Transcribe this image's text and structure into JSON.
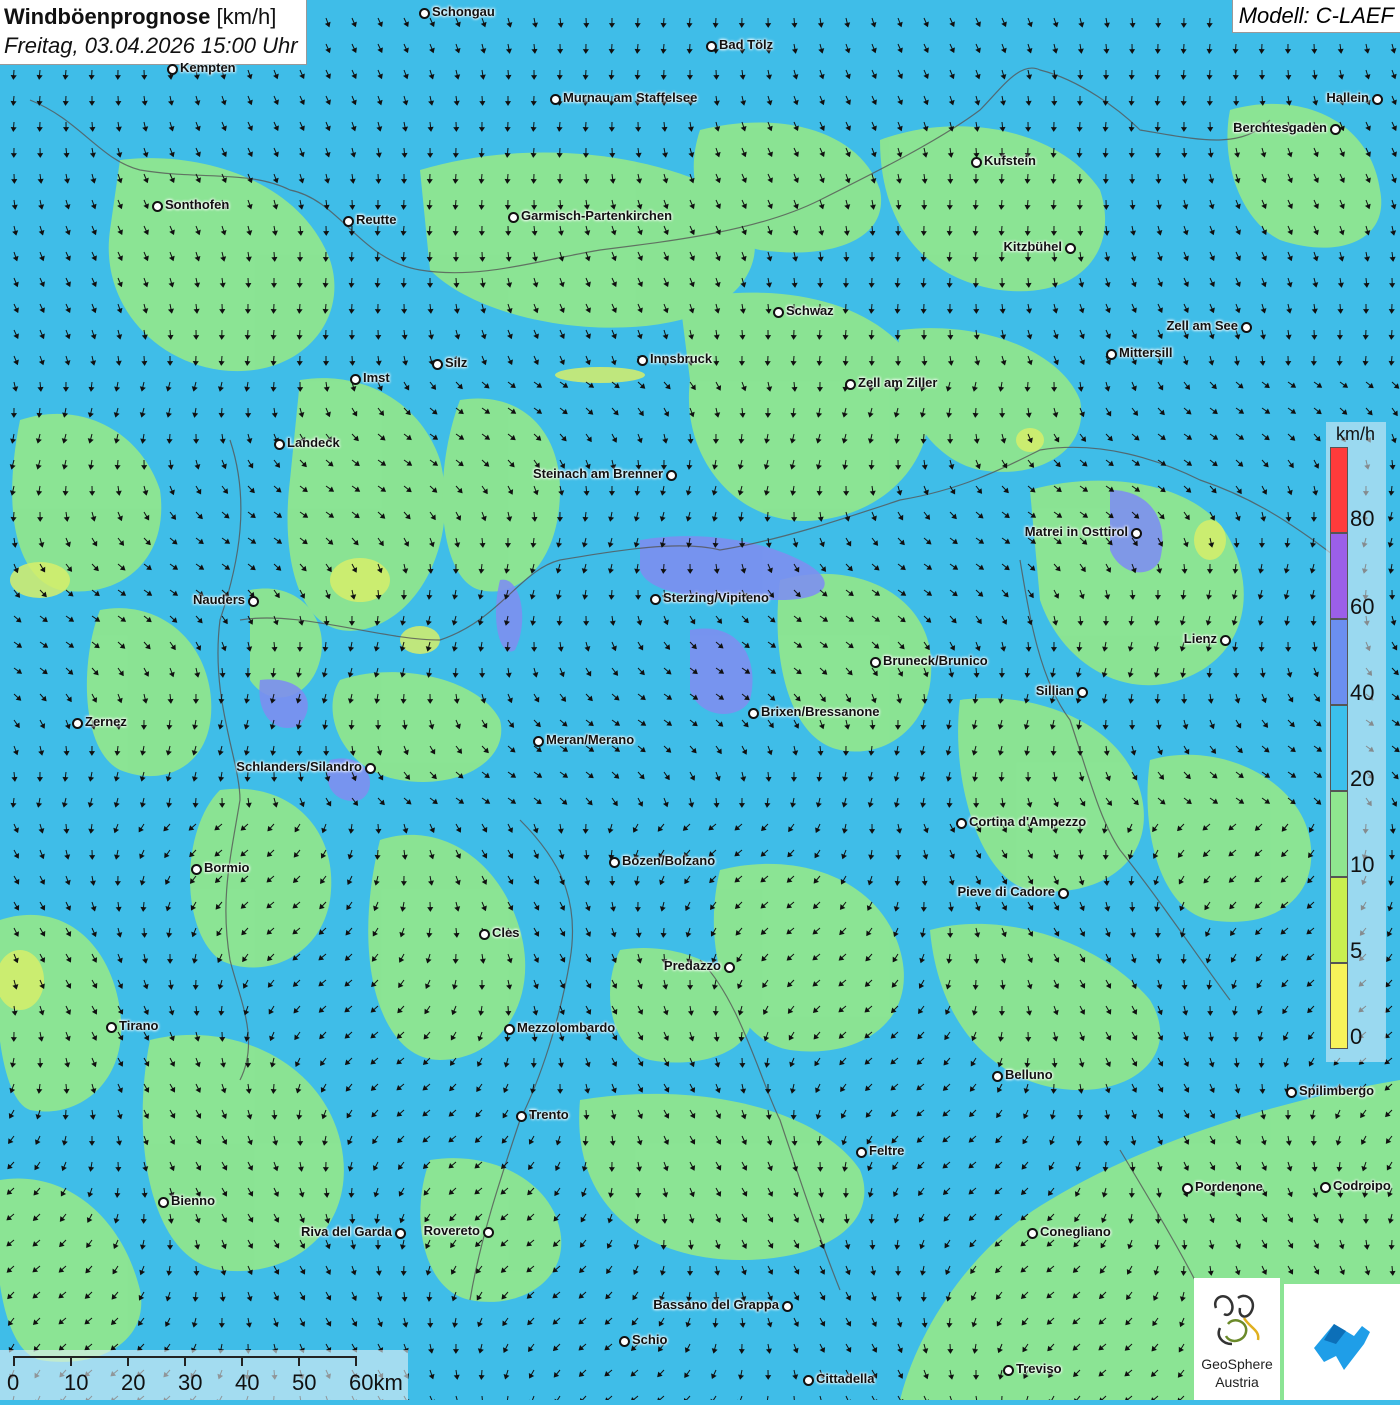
{
  "title": {
    "main": "Windböenprognose",
    "unit": "[km/h]",
    "datetime": "Freitag, 03.04.2026 15:00 Uhr"
  },
  "model": "Modell: C-LAEF",
  "legend": {
    "unit": "km/h",
    "ticks": [
      "80",
      "60",
      "40",
      "20",
      "10",
      "5",
      "0"
    ],
    "colors": [
      "#ff3b3b",
      "#9b5fe8",
      "#6b8ff0",
      "#3bc0ec",
      "#8fe68f",
      "#c9ef4f",
      "#f7f35a"
    ]
  },
  "scale": {
    "labels": [
      "0",
      "10",
      "20",
      "30",
      "40",
      "50",
      "60km"
    ]
  },
  "logos": {
    "geosphere_line1": "GeoSphere",
    "geosphere_line2": "Austria"
  },
  "cities": [
    {
      "name": "Schongau"
    },
    {
      "name": "Kempten"
    },
    {
      "name": "Bad Tölz"
    },
    {
      "name": "Murnau am Staffelsee"
    },
    {
      "name": "Hallein"
    },
    {
      "name": "Berchtesgaden"
    },
    {
      "name": "Kufstein"
    },
    {
      "name": "Sonthofen"
    },
    {
      "name": "Reutte"
    },
    {
      "name": "Garmisch-Partenkirchen"
    },
    {
      "name": "Kitzbühel"
    },
    {
      "name": "Schwaz"
    },
    {
      "name": "Zell am See"
    },
    {
      "name": "Innsbruck"
    },
    {
      "name": "Silz"
    },
    {
      "name": "Mittersill"
    },
    {
      "name": "Imst"
    },
    {
      "name": "Zell am Ziller"
    },
    {
      "name": "Landeck"
    },
    {
      "name": "Steinach am Brenner"
    },
    {
      "name": "Matrei in Osttirol"
    },
    {
      "name": "Nauders"
    },
    {
      "name": "Sterzing/Vipiteno"
    },
    {
      "name": "Lienz"
    },
    {
      "name": "Bruneck/Brunico"
    },
    {
      "name": "Sillian"
    },
    {
      "name": "Brixen/Bressanone"
    },
    {
      "name": "Zernez"
    },
    {
      "name": "Meran/Merano"
    },
    {
      "name": "Schlanders/Silandro"
    },
    {
      "name": "Cortina d'Ampezzo"
    },
    {
      "name": "Bozen/Bolzano"
    },
    {
      "name": "Bormio"
    },
    {
      "name": "Pieve di Cadore"
    },
    {
      "name": "Cles"
    },
    {
      "name": "Predazzo"
    },
    {
      "name": "Tirano"
    },
    {
      "name": "Mezzolombardo"
    },
    {
      "name": "Belluno"
    },
    {
      "name": "Spilimbergo"
    },
    {
      "name": "Trento"
    },
    {
      "name": "Feltre"
    },
    {
      "name": "Pordenone"
    },
    {
      "name": "Codroipo"
    },
    {
      "name": "Bienno"
    },
    {
      "name": "Riva del Garda"
    },
    {
      "name": "Rovereto"
    },
    {
      "name": "Conegliano"
    },
    {
      "name": "Bassano del Grappa"
    },
    {
      "name": "Schio"
    },
    {
      "name": "Treviso"
    },
    {
      "name": "Cittadella"
    }
  ]
}
